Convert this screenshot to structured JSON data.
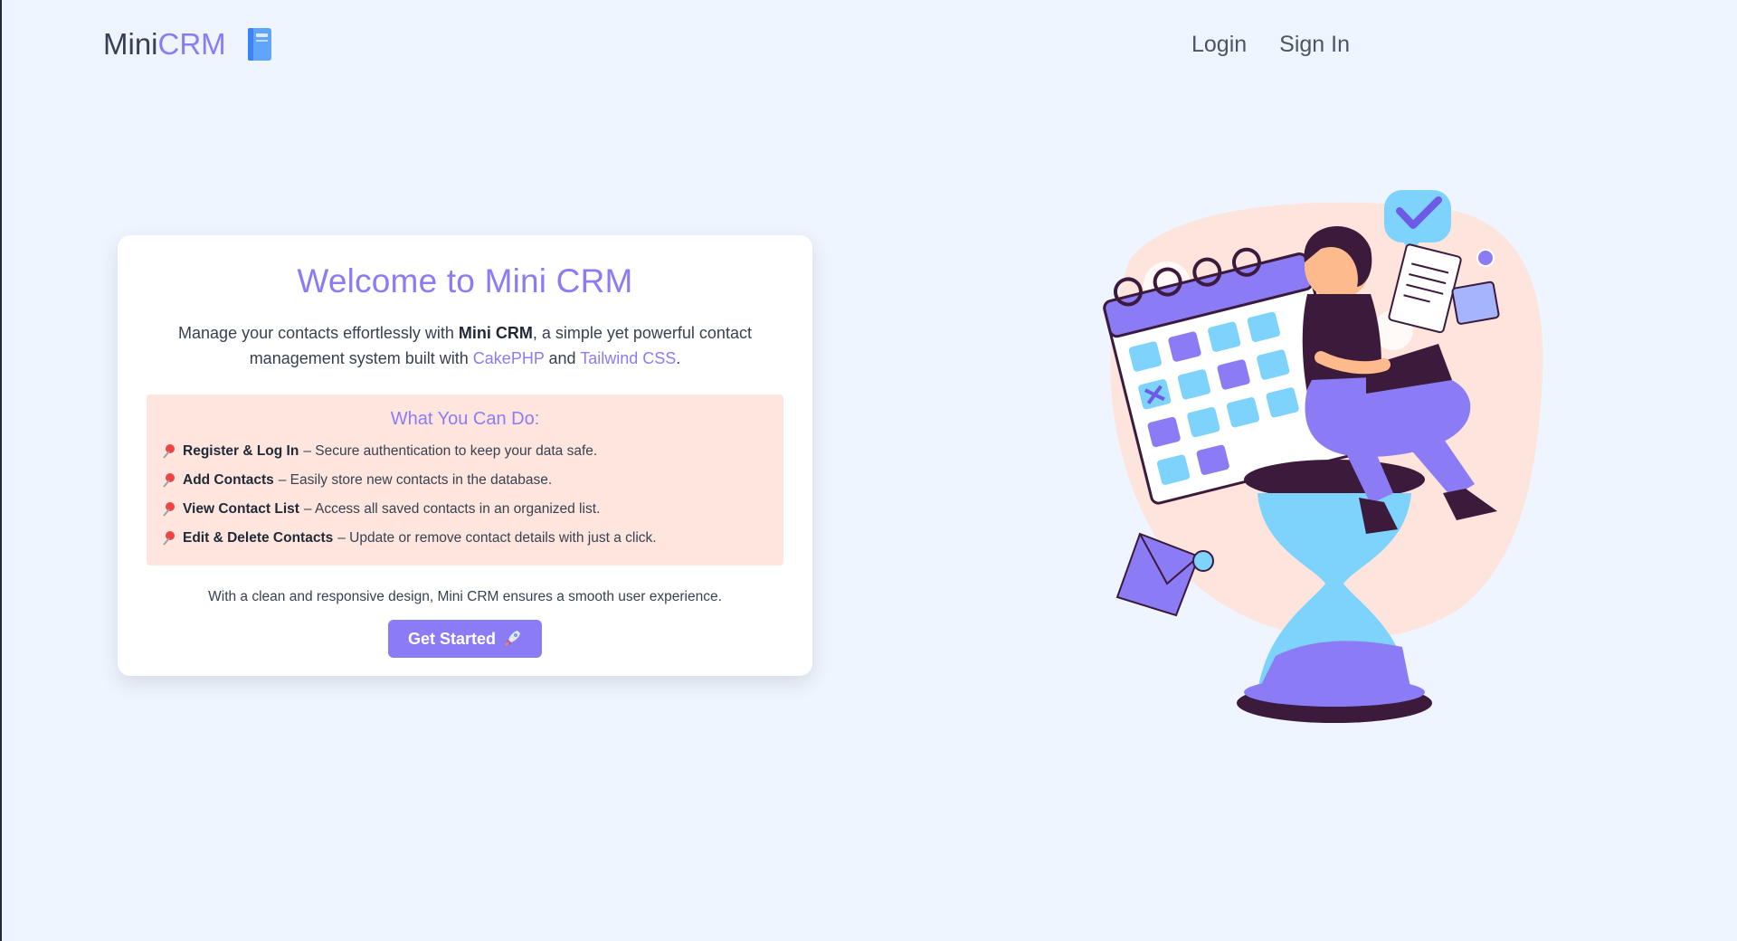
{
  "brand": {
    "part1": "Mini",
    "part2": "CRM",
    "icon": "notebook-icon"
  },
  "nav": {
    "login": "Login",
    "signin": "Sign In"
  },
  "hero": {
    "title": "Welcome to Mini CRM",
    "intro_pre": "Manage your contacts effortlessly with ",
    "intro_bold": "Mini CRM",
    "intro_mid": ", a simple yet powerful contact management system built with ",
    "link_cakephp": "CakePHP",
    "intro_and": " and ",
    "link_tailwind": "Tailwind CSS",
    "intro_end": "."
  },
  "features": {
    "heading": "What You Can Do:",
    "items": [
      {
        "icon": "pushpin-icon",
        "title": "Register & Log In",
        "desc": "– Secure authentication to keep your data safe."
      },
      {
        "icon": "pushpin-icon",
        "title": "Add Contacts",
        "desc": "– Easily store new contacts in the database."
      },
      {
        "icon": "pushpin-icon",
        "title": "View Contact List",
        "desc": "– Access all saved contacts in an organized list."
      },
      {
        "icon": "pushpin-icon",
        "title": "Edit & Delete Contacts",
        "desc": "– Update or remove contact details with just a click."
      }
    ]
  },
  "footer_note": "With a clean and responsive design, Mini CRM ensures a smooth user experience.",
  "cta": {
    "label": "Get Started",
    "icon": "rocket-icon"
  },
  "colors": {
    "accent": "#8b7cf6",
    "background": "#eff5fe",
    "feature_bg": "#fee6df"
  }
}
